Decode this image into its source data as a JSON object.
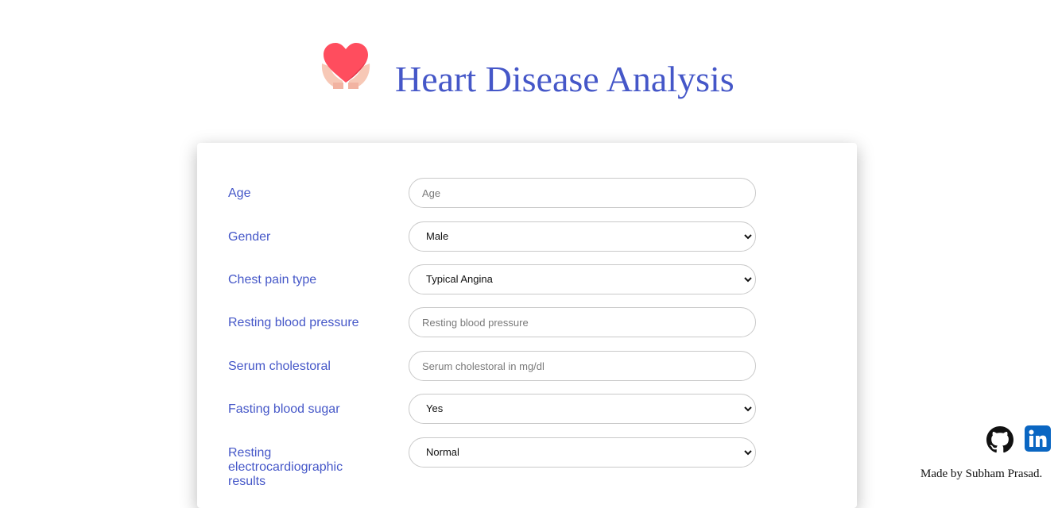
{
  "header": {
    "title": "Heart Disease Analysis",
    "logo_icon": "heart-in-hands-icon"
  },
  "form": {
    "fields": [
      {
        "label": "Age",
        "type": "text",
        "value": "",
        "placeholder": "Age"
      },
      {
        "label": "Gender",
        "type": "select",
        "value": "Male"
      },
      {
        "label": "Chest pain type",
        "type": "select",
        "value": "Typical Angina"
      },
      {
        "label": "Resting blood pressure",
        "type": "text",
        "value": "",
        "placeholder": "Resting blood pressure"
      },
      {
        "label": "Serum cholestoral",
        "type": "text",
        "value": "",
        "placeholder": "Serum cholestoral in mg/dl"
      },
      {
        "label": "Fasting blood sugar",
        "type": "select",
        "value": "Yes"
      },
      {
        "label": "Resting electrocardiographic results",
        "type": "select",
        "value": "Normal"
      }
    ]
  },
  "footer": {
    "github_icon": "github-icon",
    "linkedin_icon": "linkedin-icon",
    "made_by": "Made by Subham Prasad."
  },
  "colors": {
    "accent": "#4557c8",
    "heart": "#ff4d5e",
    "linkedin": "#0a66c2"
  }
}
